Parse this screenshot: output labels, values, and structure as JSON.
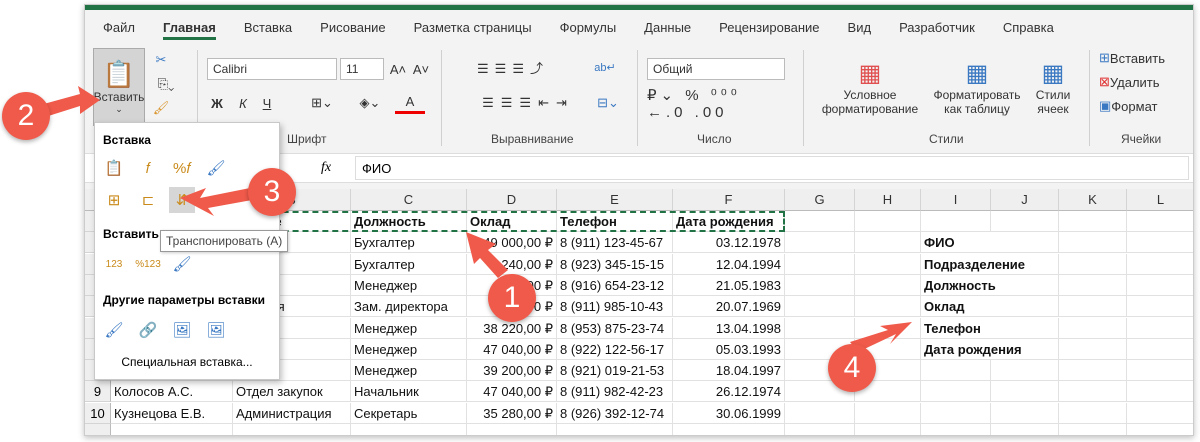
{
  "tabs": [
    "Файл",
    "Главная",
    "Вставка",
    "Рисование",
    "Разметка страницы",
    "Формулы",
    "Данные",
    "Рецензирование",
    "Вид",
    "Разработчик",
    "Справка"
  ],
  "ribbon": {
    "paste_label": "Вставить",
    "font_name": "Calibri",
    "font_size": "11",
    "bold": "Ж",
    "italic": "К",
    "underline": "Ч",
    "font_group": "Шрифт",
    "align_group": "Выравнивание",
    "number_format": "Общий",
    "number_group": "Число",
    "cond_format": "Условное форматирование",
    "format_table": "Форматировать как таблицу",
    "cell_styles": "Стили ячеек",
    "styles_group": "Стили",
    "insert": "Вставить",
    "delete": "Удалить",
    "format": "Формат",
    "cells_group": "Ячейки"
  },
  "formula": {
    "fx": "fx",
    "value": "ФИО"
  },
  "columns": [
    "C",
    "D",
    "E",
    "F",
    "G",
    "H",
    "I",
    "J",
    "K",
    "L"
  ],
  "header_row": [
    "еление",
    "Должность",
    "Оклад",
    "Телефон",
    "Дата рождения"
  ],
  "rows": [
    [
      "рия",
      "Бухгалтер",
      "49 000,00 ₽",
      "8 (911) 123-45-67",
      "03.12.1978"
    ],
    [
      "рия",
      "Бухгалтер",
      "240,00 ₽",
      "8 (923) 345-15-15",
      "12.04.1994"
    ],
    [
      "купок",
      "Менеджер",
      "00 ₽",
      "8 (916) 654-23-12",
      "21.05.1983"
    ],
    [
      "страция",
      "Зам. директора",
      "0 ₽",
      "8 (911) 985-10-43",
      "20.07.1969"
    ],
    [
      "родаж",
      "Менеджер",
      "38 220,00 ₽",
      "8 (953) 875-23-74",
      "13.04.1998"
    ],
    [
      "родаж",
      "Менеджер",
      "47 040,00 ₽",
      "8 (922) 122-56-17",
      "05.03.1993"
    ],
    [
      "купок",
      "Менеджер",
      "39 200,00 ₽",
      "8 (921) 019-21-53",
      "18.04.1997"
    ]
  ],
  "full_rows": [
    {
      "n": "9",
      "a": "Колосов А.С.",
      "b": "Отдел закупок",
      "c": "Начальник",
      "d": "47 040,00 ₽",
      "e": "8 (911) 982-42-23",
      "f": "26.12.1974"
    },
    {
      "n": "10",
      "a": "Кузнецова Е.В.",
      "b": "Администрация",
      "c": "Секретарь",
      "d": "35 280,00 ₽",
      "e": "8 (926) 392-12-74",
      "f": "30.06.1999"
    }
  ],
  "transposed": [
    "ФИО",
    "Подразделение",
    "Должность",
    "Оклад",
    "Телефон",
    "Дата рождения"
  ],
  "menu": {
    "h1": "Вставка",
    "h2": "Вставить",
    "h3": "Другие параметры вставки",
    "special": "Специальная вставка...",
    "tooltip": "Транспонировать (A)"
  },
  "badges": [
    "1",
    "2",
    "3",
    "4"
  ],
  "colors": {
    "accent": "#217346",
    "annotation": "#f05a4a"
  }
}
